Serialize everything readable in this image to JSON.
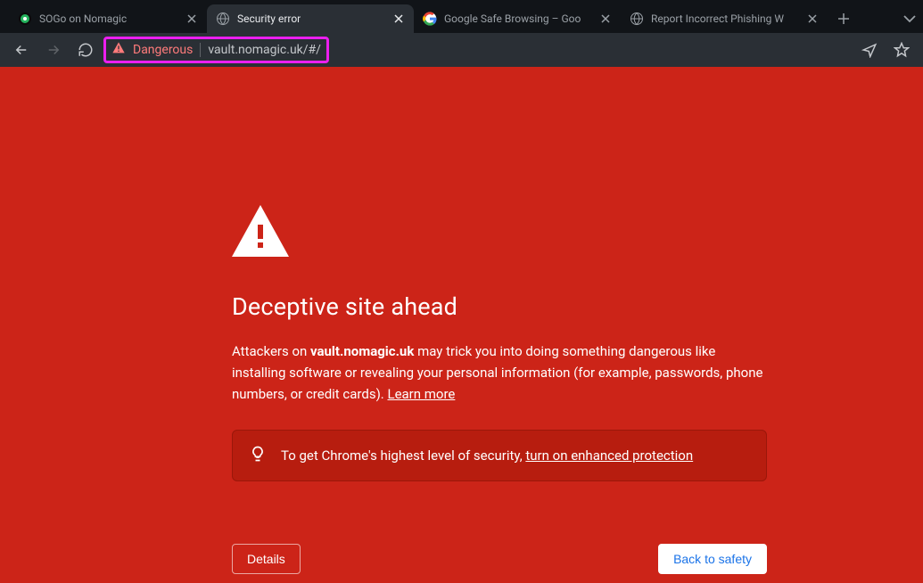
{
  "tabs": [
    {
      "title": "SOGo on Nomagic"
    },
    {
      "title": "Security error"
    },
    {
      "title": "Google Safe Browsing – Goo"
    },
    {
      "title": "Report Incorrect Phishing W"
    }
  ],
  "omnibox": {
    "dangerous": "Dangerous",
    "url": "vault.nomagic.uk/#/"
  },
  "warning": {
    "title": "Deceptive site ahead",
    "body_prefix": "Attackers on ",
    "domain": "vault.nomagic.uk",
    "body_suffix": " may trick you into doing something dangerous like installing software or revealing your personal information (for example, passwords, phone numbers, or credit cards). ",
    "learn_more": "Learn more",
    "banner_prefix": "To get Chrome's highest level of security, ",
    "banner_link": "turn on enhanced protection",
    "details_button": "Details",
    "back_button": "Back to safety"
  }
}
